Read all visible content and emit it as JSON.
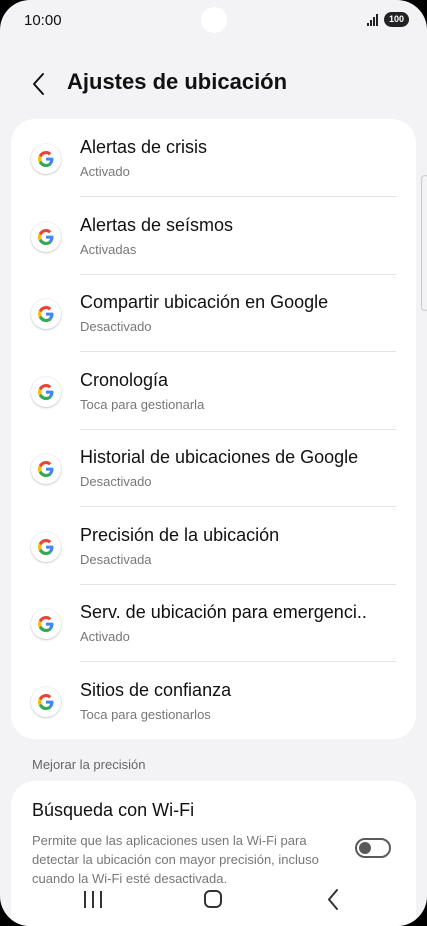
{
  "status_bar": {
    "time": "10:00",
    "battery": "100"
  },
  "header": {
    "title": "Ajustes de ubicación"
  },
  "items": [
    {
      "title": "Alertas de crisis",
      "subtitle": "Activado"
    },
    {
      "title": "Alertas de seísmos",
      "subtitle": "Activadas"
    },
    {
      "title": "Compartir ubicación en Google",
      "subtitle": "Desactivado"
    },
    {
      "title": "Cronología",
      "subtitle": "Toca para gestionarla"
    },
    {
      "title": "Historial de ubicaciones de Google",
      "subtitle": "Desactivado"
    },
    {
      "title": "Precisión de la ubicación",
      "subtitle": "Desactivada"
    },
    {
      "title": "Serv. de ubicación para emergenci..",
      "subtitle": "Activado"
    },
    {
      "title": "Sitios de confianza",
      "subtitle": "Toca para gestionarlos"
    }
  ],
  "section": {
    "label": "Mejorar la precisión"
  },
  "wifi_scan": {
    "title": "Búsqueda con Wi-Fi",
    "description": "Permite que las aplicaciones usen la Wi-Fi para detectar la ubicación con mayor precisión, incluso cuando la Wi-Fi esté desactivada.",
    "enabled": false
  },
  "icons": {
    "item_icon": "google-g-icon",
    "back": "chevron-left-icon",
    "nav_recent": "recent-apps-icon",
    "nav_home": "home-icon",
    "nav_back": "back-arrow-icon"
  },
  "colors": {
    "background": "#f3f3f6",
    "card": "#ffffff",
    "google_blue": "#4285F4",
    "google_red": "#EA4335",
    "google_yellow": "#FBBC05",
    "google_green": "#34A853"
  }
}
